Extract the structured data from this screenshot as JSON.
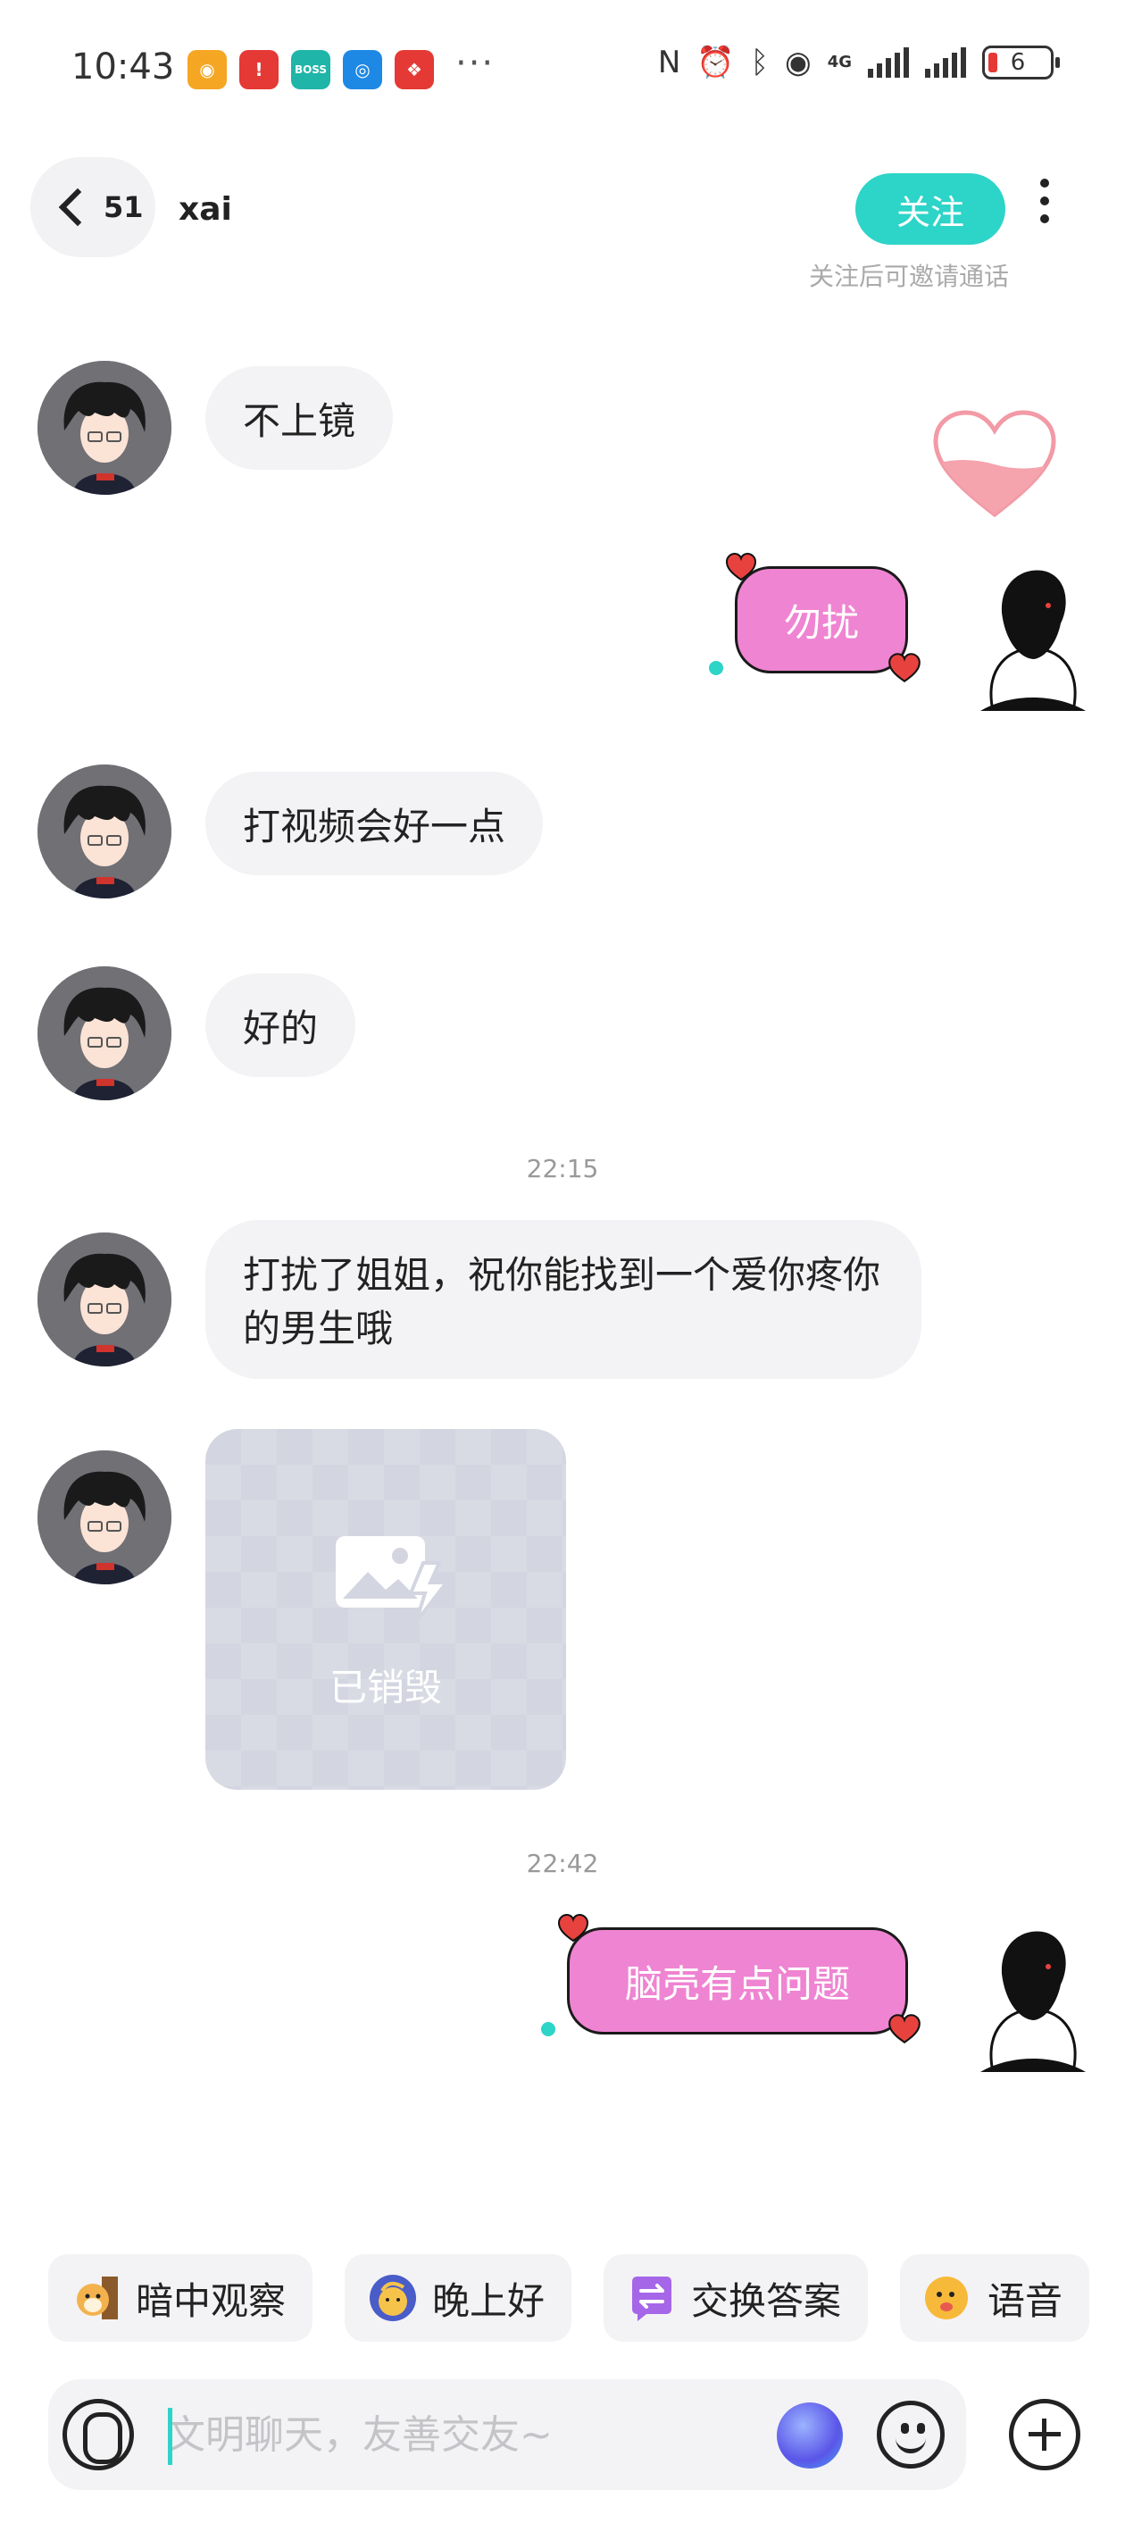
{
  "status_bar": {
    "time": "10:43",
    "app_icons": [
      {
        "name": "weibo-icon",
        "color": "#f5a623",
        "glyph": "◉"
      },
      {
        "name": "alert-app-icon",
        "color": "#e53935",
        "glyph": "!"
      },
      {
        "name": "boss-app-icon",
        "color": "#1fb5a8",
        "glyph": "BOSS"
      },
      {
        "name": "blue-app-icon",
        "color": "#1e88e5",
        "glyph": "◎"
      },
      {
        "name": "red-app-icon",
        "color": "#e53935",
        "glyph": "❖"
      }
    ],
    "more": "···",
    "network_label": "4G",
    "battery": "6"
  },
  "header": {
    "unread_count": "51",
    "contact_name": "xai",
    "follow_label": "关注",
    "follow_hint": "关注后可邀请通话"
  },
  "messages": [
    {
      "side": "left",
      "text": "不上镜"
    },
    {
      "side": "right",
      "text": "勿扰"
    },
    {
      "side": "left",
      "text": "打视频会好一点"
    },
    {
      "side": "left",
      "text": "好的"
    },
    {
      "type": "time",
      "text": "22:15"
    },
    {
      "side": "left",
      "text": "打扰了姐姐，祝你能找到一个爱你疼你的男生哦"
    },
    {
      "side": "left",
      "type": "destroyed-image",
      "text": "已销毁"
    },
    {
      "type": "time",
      "text": "22:42"
    },
    {
      "side": "right",
      "text": "脑壳有点问题"
    }
  ],
  "quick_replies": [
    {
      "icon": "dog-icon",
      "label": "暗中观察"
    },
    {
      "icon": "moon-face-icon",
      "label": "晚上好"
    },
    {
      "icon": "swap-icon",
      "label": "交换答案"
    },
    {
      "icon": "voice-emoji-icon",
      "label": "语音"
    }
  ],
  "input": {
    "placeholder": "文明聊天，友善交友~"
  },
  "colors": {
    "accent": "#2dd4c8",
    "pink_bubble": "#ef84d2",
    "gray_bubble": "#f3f3f5"
  }
}
